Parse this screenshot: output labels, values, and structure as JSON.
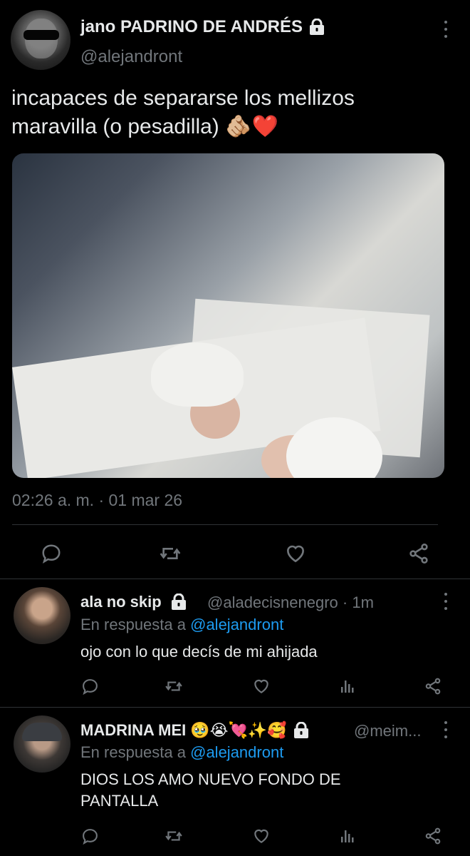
{
  "main_tweet": {
    "display_name": "jano PADRINO DE ANDRÉS",
    "handle": "@alejandront",
    "text": "incapaces de separarse los mellizos maravilla (o pesadilla) 🫵🏼❤️",
    "timestamp": "02:26 a. m. · 01 mar 26",
    "protected": true
  },
  "replies": [
    {
      "display_name": "ala no skip",
      "handle_time": "@aladecisnenegro · 1m",
      "reply_to_prefix": "En respuesta a",
      "reply_to_mention": "@alejandront",
      "text": "ojo con lo que decís de mi ahijada",
      "protected": true
    },
    {
      "display_name": "MADRINA MEI 🥹😭💘✨🥰",
      "handle_time": "@meim...",
      "reply_to_prefix": "En respuesta a",
      "reply_to_mention": "@alejandront",
      "text_line1": "DIOS LOS AMO NUEVO FONDO DE",
      "text_line2": "PANTALLA",
      "protected": true
    }
  ],
  "icons": {
    "reply": "reply-icon",
    "retweet": "retweet-icon",
    "like": "heart-icon",
    "views": "views-icon",
    "share": "share-icon",
    "more": "more-vertical-icon",
    "lock": "lock-icon"
  },
  "colors": {
    "background": "#000000",
    "text": "#e7e9ea",
    "secondary": "#71767b",
    "link": "#1d9bf0",
    "divider": "#2f3336"
  }
}
